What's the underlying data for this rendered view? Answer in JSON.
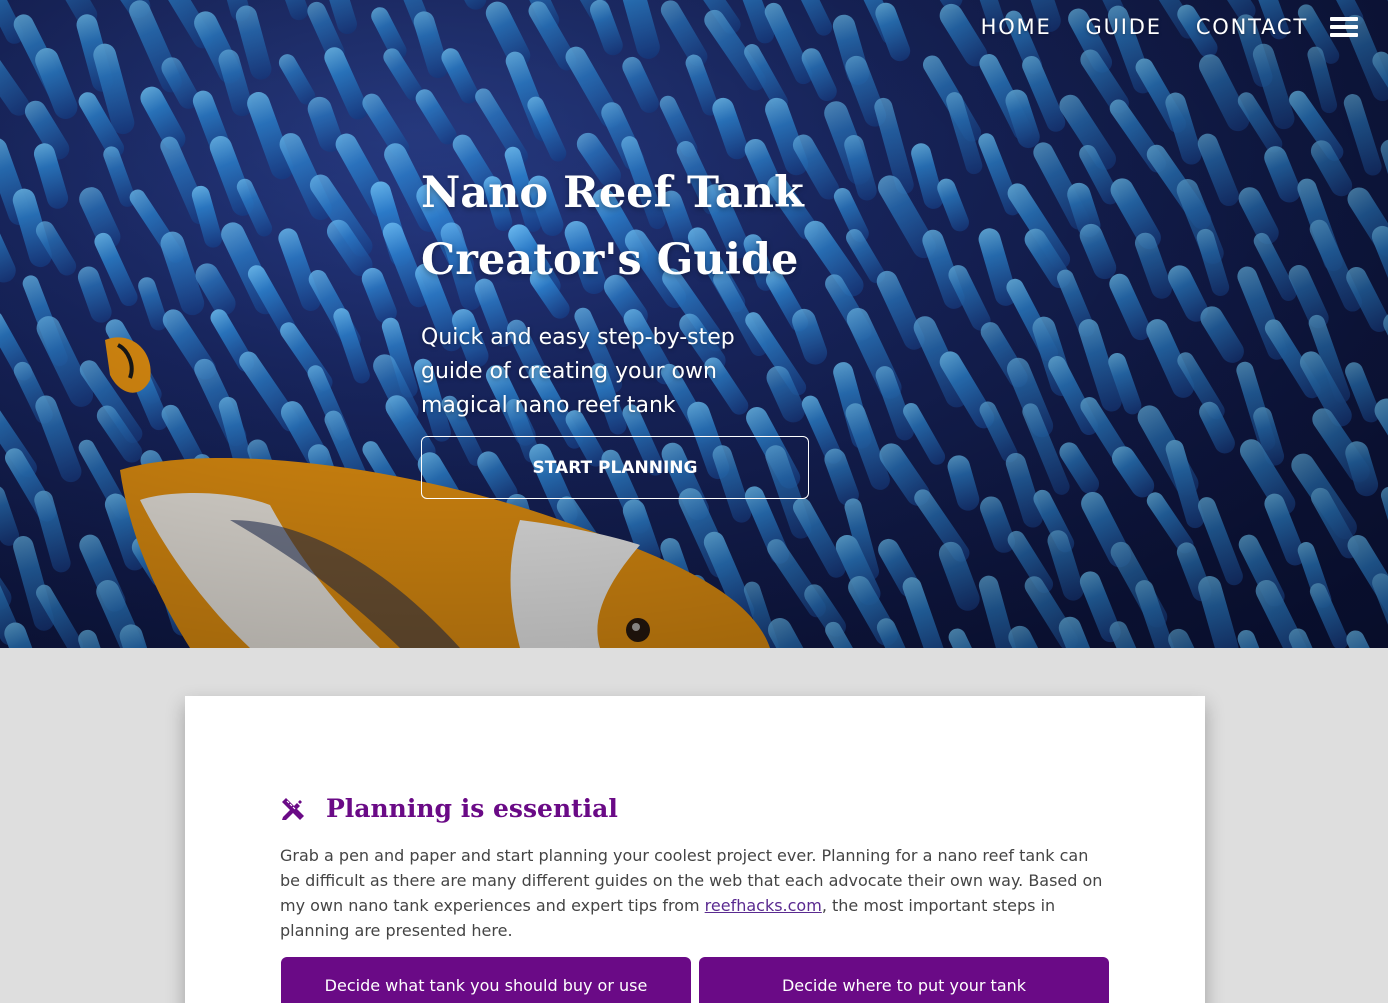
{
  "nav": {
    "items": [
      {
        "label": "HOME"
      },
      {
        "label": "GUIDE"
      },
      {
        "label": "CONTACT"
      }
    ],
    "menu_icon": "hamburger-menu-icon"
  },
  "hero": {
    "title_line1": "Nano Reef Tank",
    "title_line2": "Creator's Guide",
    "subtitle": "Quick and easy step-by-step guide of creating your own magical nano reef tank",
    "cta_label": "START PLANNING"
  },
  "planning": {
    "icon": "pencil-ruler-icon",
    "title": "Planning is essential",
    "text_before_link": "Grab a pen and paper and start planning your coolest project ever. Planning for a nano reef tank can be difficult as there are many different guides on the web that each advocate their own way. Based on my own nano tank experiences and expert tips from ",
    "link_text": "reefhacks.com",
    "text_after_link": ", the most important steps in planning are presented here.",
    "buttons": [
      {
        "label": "Decide what tank you should buy or use"
      },
      {
        "label": "Decide where to put your tank"
      }
    ]
  },
  "colors": {
    "accent": "#6a0a86",
    "page_bg": "#dedede",
    "hero_bg": "#1b2a6b",
    "anemone": "#3a8fe0",
    "clownfish_orange": "#f29a12"
  }
}
